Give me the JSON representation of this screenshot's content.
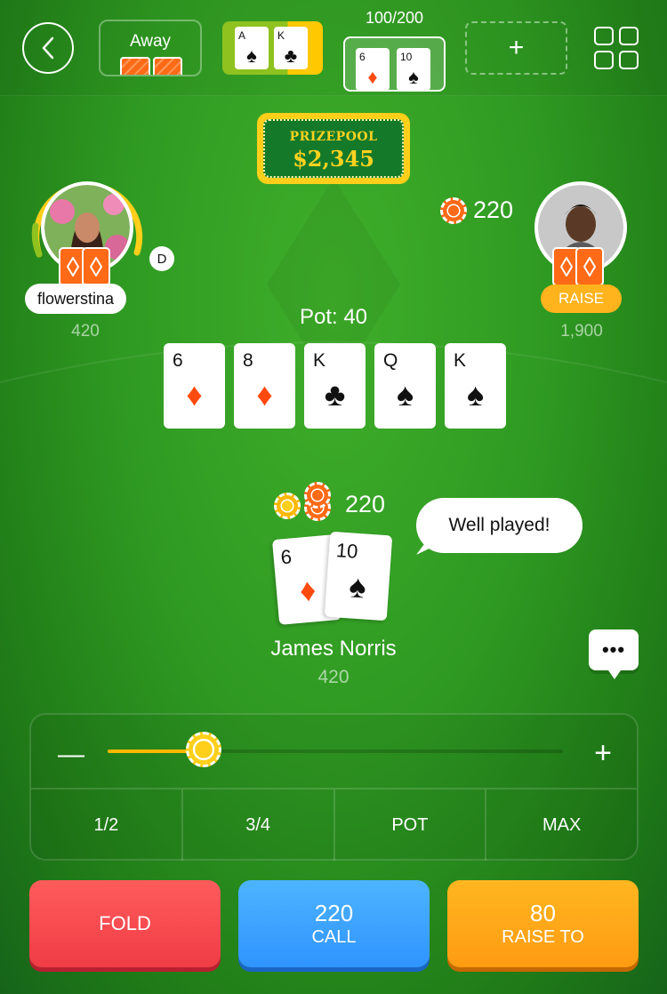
{
  "topbar": {
    "away_label": "Away",
    "blinds": "100/200",
    "add_table_label": "+",
    "tab1_cards": [
      {
        "rank": "A",
        "suit": "♠"
      },
      {
        "rank": "K",
        "suit": "♣"
      }
    ],
    "tab2_cards": [
      {
        "rank": "6",
        "suit": "♦"
      },
      {
        "rank": "10",
        "suit": "♠"
      }
    ]
  },
  "prizepool": {
    "label": "PRIZEPOOL",
    "value": "$2,345"
  },
  "players": {
    "left": {
      "name": "flowerstina",
      "stack": "420",
      "dealer_badge": "D"
    },
    "right": {
      "stack": "1,900",
      "action": "RAISE",
      "bet": "220"
    }
  },
  "table": {
    "pot": "Pot: 40",
    "board": [
      {
        "rank": "6",
        "suit": "♦"
      },
      {
        "rank": "8",
        "suit": "♦"
      },
      {
        "rank": "K",
        "suit": "♣"
      },
      {
        "rank": "Q",
        "suit": "♠"
      },
      {
        "rank": "K",
        "suit": "♠"
      }
    ]
  },
  "hero": {
    "name": "James Norris",
    "stack": "420",
    "bet": "220",
    "cards": [
      {
        "rank": "6",
        "suit": "♦"
      },
      {
        "rank": "10",
        "suit": "♠"
      }
    ],
    "chat_message": "Well played!"
  },
  "chat_button_label": "•••",
  "bet_panel": {
    "minus": "—",
    "plus": "+",
    "slider_fraction": 0.21,
    "presets": [
      "1/2",
      "3/4",
      "POT",
      "MAX"
    ]
  },
  "actions": {
    "fold_label": "FOLD",
    "call_amount": "220",
    "call_label": "CALL",
    "raise_amount": "80",
    "raise_label": "RAISE TO"
  },
  "colors": {
    "felt": "#2f9a22",
    "accent_orange": "#ff6a16",
    "gold": "#ffcf1a",
    "fold": "#f03c45",
    "call": "#2f94ff",
    "raise": "#ff9b12"
  }
}
